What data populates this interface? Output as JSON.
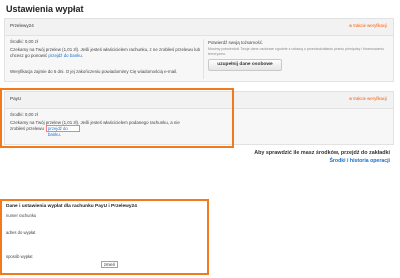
{
  "page": {
    "title": "Ustawienia wypłat"
  },
  "przelewy24": {
    "name": "Przelewy24",
    "status": "w trakcie weryfikacji",
    "balance": "Środki: 0,00 zł",
    "desc_prefix": "Czekamy na Twój przelew (1,01 zł). Jeśli jesteś właścicielem rachunku, z ne zrobiłeś przelewu lub chcesz go ponowić",
    "desc_link": "przejdź do banku",
    "desc_suffix": ".",
    "note": "Weryfikacja zajmie do 5 dni. O jej zakończeniu powiadomimy Cię wiadomością e-mail.",
    "identity_title": "Potwierdź swoją tożsamość.",
    "identity_desc": "Musimy potwierdzić Twoje dane osobowe zgodnie z ustawą o przeciwdziałaniu praniu pieniędzy i finansowaniu terroryzmu.",
    "identity_button": "uzupełnij dane osobowe"
  },
  "payu": {
    "name": "PayU",
    "status": "w trakcie weryfikacji",
    "balance": "Środki: 0,00 zł",
    "desc_prefix": "Czekamy na Twój przelew (1,01 zł). Jeśli jesteś właścicielem podanego rachunku, a nie zrobiłeś przelewu",
    "desc_link": "przejdź do banku."
  },
  "balance_info": {
    "text": "Aby sprawdzić ile masz środków, przejdź do zakładki",
    "link": "Środki i historia operacji"
  },
  "payout_form": {
    "title": "Dane i ustawienia wypłat dla rachunku PayU i Przelewy24",
    "account_number_label": "numer rachunku",
    "address_label": "adres do wypłat",
    "method_label": "sposób wypłat",
    "save_button": "zmień"
  },
  "colors": {
    "accent_orange": "#f07a1c",
    "link_blue": "#1a6fc9",
    "status_orange": "#ff5a00"
  }
}
